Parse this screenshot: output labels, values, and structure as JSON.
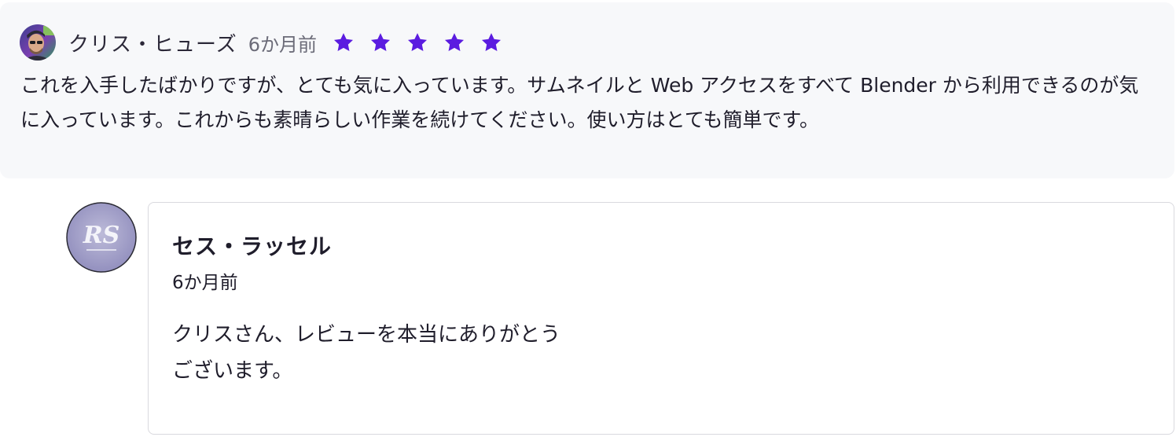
{
  "review": {
    "author_name": "クリス・ヒューズ",
    "time": "6か月前",
    "rating": 5,
    "rating_max": 5,
    "star_color": "#5b1ce0",
    "avatar_icon": "user-avatar",
    "body": "これを入手したばかりですが、とても気に入っています。サムネイルと Web アクセスをすべて Blender から利用できるのが気に入っています。これからも素晴らしい作業を続けてください。使い方はとても簡単です。"
  },
  "reply": {
    "author_name": "セス・ラッセル",
    "time": "6か月前",
    "avatar_icon": "rs-logo-avatar",
    "avatar_logo_text": "RS",
    "body": "クリスさん、レビューを本当にありがとうございます。"
  }
}
